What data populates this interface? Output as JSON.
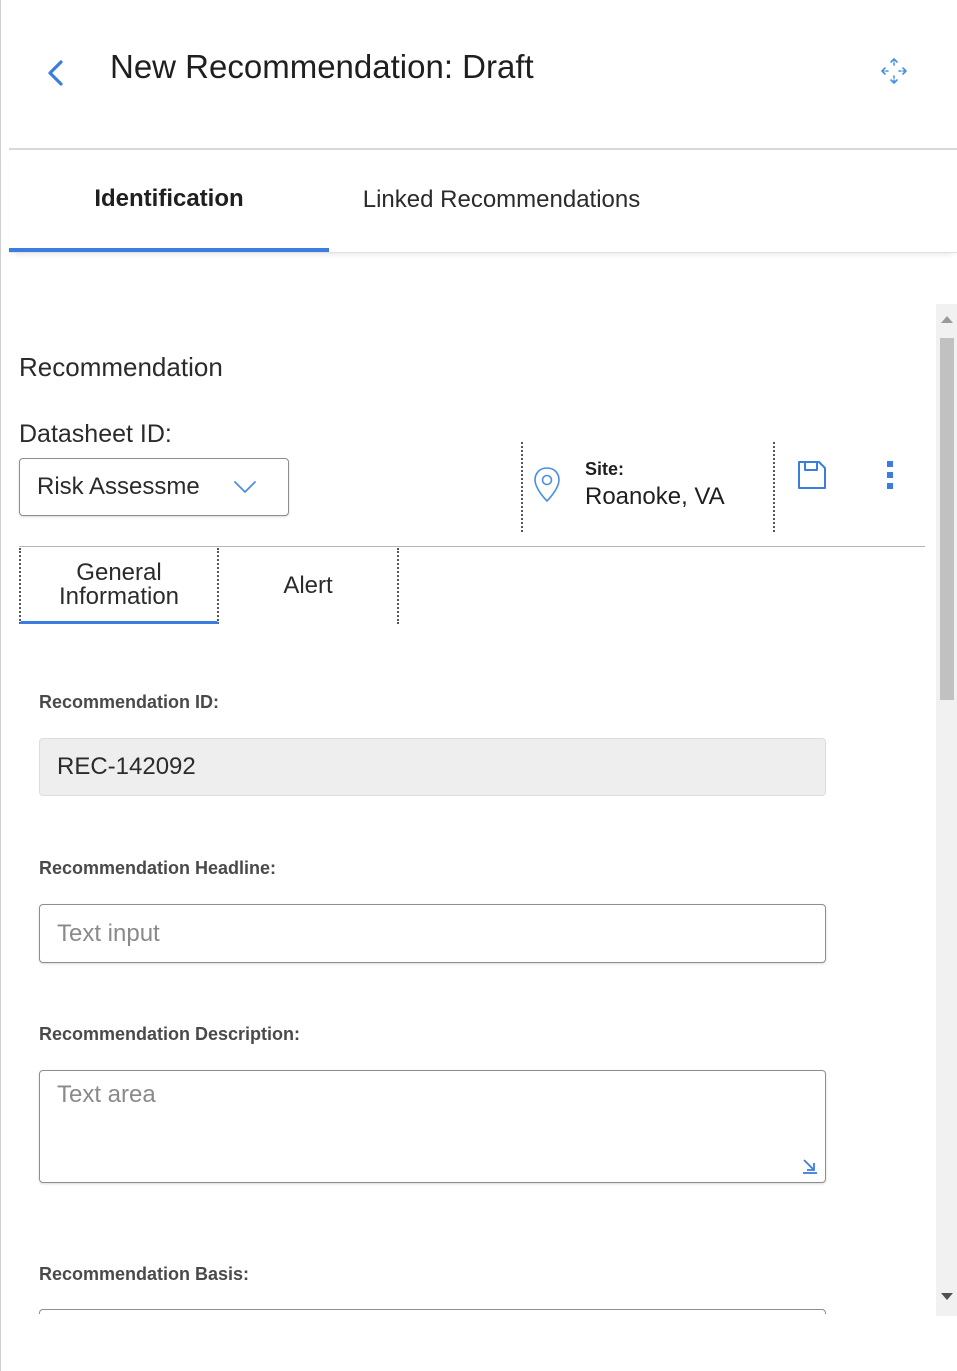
{
  "header": {
    "title": "New Recommendation: Draft"
  },
  "tabs": [
    {
      "label": "Identification",
      "active": true
    },
    {
      "label": "Linked Recommendations",
      "active": false
    }
  ],
  "section": {
    "title": "Recommendation",
    "datasheet": {
      "label": "Datasheet ID:",
      "value": "Risk Assessme"
    },
    "site": {
      "label": "Site:",
      "value": "Roanoke, VA"
    }
  },
  "subtabs": [
    {
      "label": "General Information",
      "active": true
    },
    {
      "label": "Alert",
      "active": false
    }
  ],
  "fields": {
    "recommendation_id": {
      "label": "Recommendation ID:",
      "value": "REC-142092"
    },
    "headline": {
      "label": "Recommendation Headline:",
      "placeholder": "Text input"
    },
    "description": {
      "label": "Recommendation Description:",
      "placeholder": "Text area"
    },
    "basis": {
      "label": "Recommendation Basis:"
    }
  },
  "colors": {
    "accent": "#3b7ddd",
    "icon_blue": "#4a90e2"
  },
  "icons": {
    "back": "chevron-left-icon",
    "move": "move-arrows-icon",
    "dropdown": "chevron-down-icon",
    "site": "map-pin-icon",
    "save": "save-icon",
    "more": "more-vertical-icon",
    "resize": "resize-handle-icon"
  }
}
